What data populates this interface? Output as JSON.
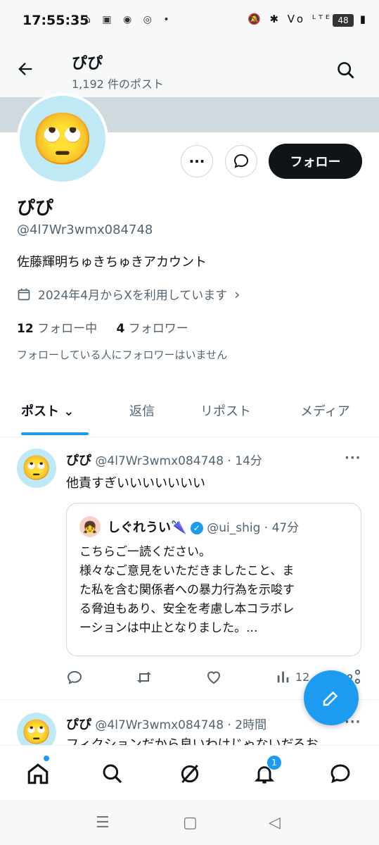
{
  "status": {
    "time": "17:55:35",
    "icons_left": "⌂ ▣ ◉ ◎ •",
    "icons_right": "🔕 ✱ Vo ᴸᵀᴱ ⁵ᴳ ▮",
    "battery": "48"
  },
  "header": {
    "title": "ぴぴ",
    "subtitle": "1,192 件のポスト"
  },
  "profile": {
    "more_label": "···",
    "follow_label": "フォロー",
    "name": "ぴぴ",
    "handle": "@4l7Wr3wmx084748",
    "bio": "佐藤輝明ちゅきちゅきアカウント",
    "joined": "2024年4月からXを利用しています",
    "following_count": "12",
    "following_label": "フォロー中",
    "followers_count": "4",
    "followers_label": "フォロワー",
    "note": "フォローしている人にフォロワーはいません",
    "avatar_emoji": "🙄"
  },
  "tabs": [
    {
      "label": "ポスト ⌄"
    },
    {
      "label": "返信"
    },
    {
      "label": "リポスト"
    },
    {
      "label": "メディア"
    }
  ],
  "posts": [
    {
      "name": "ぴぴ",
      "handle": "@4l7Wr3wmx084748",
      "time": "· 14分",
      "text": "他責すぎいいいいいいい",
      "quote": {
        "name": "しぐれうい🌂",
        "handle": "@ui_shig",
        "time": "· 47分",
        "lines": [
          "こちらご一読ください。",
          "様々なご意見をいただきましたこと、ま",
          "た私を含む関係者への暴力行為を示唆す",
          "る脅迫もあり、安全を考慮し本コラボレ",
          "ーションは中止となりました。..."
        ]
      },
      "views": "12"
    },
    {
      "name": "ぴぴ",
      "handle": "@4l7Wr3wmx084748",
      "time": "· 2時間",
      "text": "フィクションだから良いわけじゃないだろお"
    }
  ],
  "nav": {
    "notif_count": "1"
  },
  "colors": {
    "accent": "#1d9bf0",
    "text": "#0f1419",
    "muted": "#536471"
  }
}
